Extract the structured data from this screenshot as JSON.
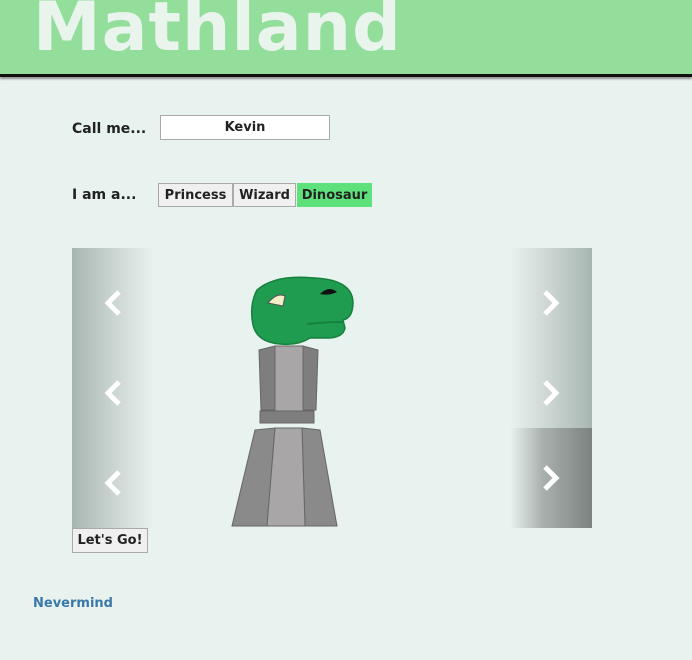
{
  "header": {
    "title": "Mathland",
    "color": "#93de9b"
  },
  "form": {
    "name_label": "Call me...",
    "name_value": "Kevin",
    "role_label": "I am a...",
    "roles": [
      "Princess",
      "Wizard",
      "Dinosaur"
    ],
    "selected_role": "Dinosaur",
    "active_color": "#5ee07a"
  },
  "carousel": {
    "left_icons": [
      "chevron-left-icon",
      "chevron-left-icon",
      "chevron-left-icon"
    ],
    "right_icons": [
      "chevron-right-icon",
      "chevron-right-icon",
      "chevron-right-icon"
    ]
  },
  "actions": {
    "go_label": "Let's Go!",
    "nevermind_label": "Nevermind"
  }
}
